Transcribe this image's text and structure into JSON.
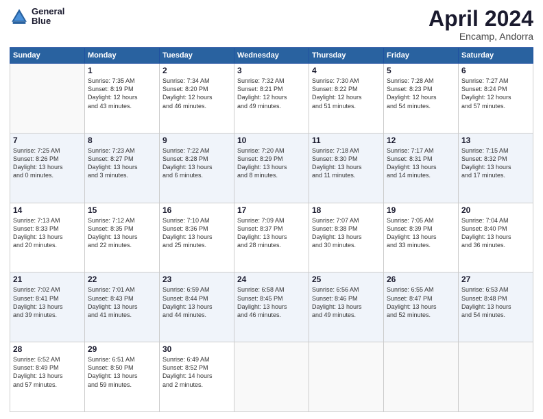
{
  "logo": {
    "line1": "General",
    "line2": "Blue"
  },
  "title": "April 2024",
  "subtitle": "Encamp, Andorra",
  "days_of_week": [
    "Sunday",
    "Monday",
    "Tuesday",
    "Wednesday",
    "Thursday",
    "Friday",
    "Saturday"
  ],
  "weeks": [
    [
      {
        "day": "",
        "info": ""
      },
      {
        "day": "1",
        "info": "Sunrise: 7:35 AM\nSunset: 8:19 PM\nDaylight: 12 hours\nand 43 minutes."
      },
      {
        "day": "2",
        "info": "Sunrise: 7:34 AM\nSunset: 8:20 PM\nDaylight: 12 hours\nand 46 minutes."
      },
      {
        "day": "3",
        "info": "Sunrise: 7:32 AM\nSunset: 8:21 PM\nDaylight: 12 hours\nand 49 minutes."
      },
      {
        "day": "4",
        "info": "Sunrise: 7:30 AM\nSunset: 8:22 PM\nDaylight: 12 hours\nand 51 minutes."
      },
      {
        "day": "5",
        "info": "Sunrise: 7:28 AM\nSunset: 8:23 PM\nDaylight: 12 hours\nand 54 minutes."
      },
      {
        "day": "6",
        "info": "Sunrise: 7:27 AM\nSunset: 8:24 PM\nDaylight: 12 hours\nand 57 minutes."
      }
    ],
    [
      {
        "day": "7",
        "info": "Sunrise: 7:25 AM\nSunset: 8:26 PM\nDaylight: 13 hours\nand 0 minutes."
      },
      {
        "day": "8",
        "info": "Sunrise: 7:23 AM\nSunset: 8:27 PM\nDaylight: 13 hours\nand 3 minutes."
      },
      {
        "day": "9",
        "info": "Sunrise: 7:22 AM\nSunset: 8:28 PM\nDaylight: 13 hours\nand 6 minutes."
      },
      {
        "day": "10",
        "info": "Sunrise: 7:20 AM\nSunset: 8:29 PM\nDaylight: 13 hours\nand 8 minutes."
      },
      {
        "day": "11",
        "info": "Sunrise: 7:18 AM\nSunset: 8:30 PM\nDaylight: 13 hours\nand 11 minutes."
      },
      {
        "day": "12",
        "info": "Sunrise: 7:17 AM\nSunset: 8:31 PM\nDaylight: 13 hours\nand 14 minutes."
      },
      {
        "day": "13",
        "info": "Sunrise: 7:15 AM\nSunset: 8:32 PM\nDaylight: 13 hours\nand 17 minutes."
      }
    ],
    [
      {
        "day": "14",
        "info": "Sunrise: 7:13 AM\nSunset: 8:33 PM\nDaylight: 13 hours\nand 20 minutes."
      },
      {
        "day": "15",
        "info": "Sunrise: 7:12 AM\nSunset: 8:35 PM\nDaylight: 13 hours\nand 22 minutes."
      },
      {
        "day": "16",
        "info": "Sunrise: 7:10 AM\nSunset: 8:36 PM\nDaylight: 13 hours\nand 25 minutes."
      },
      {
        "day": "17",
        "info": "Sunrise: 7:09 AM\nSunset: 8:37 PM\nDaylight: 13 hours\nand 28 minutes."
      },
      {
        "day": "18",
        "info": "Sunrise: 7:07 AM\nSunset: 8:38 PM\nDaylight: 13 hours\nand 30 minutes."
      },
      {
        "day": "19",
        "info": "Sunrise: 7:05 AM\nSunset: 8:39 PM\nDaylight: 13 hours\nand 33 minutes."
      },
      {
        "day": "20",
        "info": "Sunrise: 7:04 AM\nSunset: 8:40 PM\nDaylight: 13 hours\nand 36 minutes."
      }
    ],
    [
      {
        "day": "21",
        "info": "Sunrise: 7:02 AM\nSunset: 8:41 PM\nDaylight: 13 hours\nand 39 minutes."
      },
      {
        "day": "22",
        "info": "Sunrise: 7:01 AM\nSunset: 8:43 PM\nDaylight: 13 hours\nand 41 minutes."
      },
      {
        "day": "23",
        "info": "Sunrise: 6:59 AM\nSunset: 8:44 PM\nDaylight: 13 hours\nand 44 minutes."
      },
      {
        "day": "24",
        "info": "Sunrise: 6:58 AM\nSunset: 8:45 PM\nDaylight: 13 hours\nand 46 minutes."
      },
      {
        "day": "25",
        "info": "Sunrise: 6:56 AM\nSunset: 8:46 PM\nDaylight: 13 hours\nand 49 minutes."
      },
      {
        "day": "26",
        "info": "Sunrise: 6:55 AM\nSunset: 8:47 PM\nDaylight: 13 hours\nand 52 minutes."
      },
      {
        "day": "27",
        "info": "Sunrise: 6:53 AM\nSunset: 8:48 PM\nDaylight: 13 hours\nand 54 minutes."
      }
    ],
    [
      {
        "day": "28",
        "info": "Sunrise: 6:52 AM\nSunset: 8:49 PM\nDaylight: 13 hours\nand 57 minutes."
      },
      {
        "day": "29",
        "info": "Sunrise: 6:51 AM\nSunset: 8:50 PM\nDaylight: 13 hours\nand 59 minutes."
      },
      {
        "day": "30",
        "info": "Sunrise: 6:49 AM\nSunset: 8:52 PM\nDaylight: 14 hours\nand 2 minutes."
      },
      {
        "day": "",
        "info": ""
      },
      {
        "day": "",
        "info": ""
      },
      {
        "day": "",
        "info": ""
      },
      {
        "day": "",
        "info": ""
      }
    ]
  ]
}
